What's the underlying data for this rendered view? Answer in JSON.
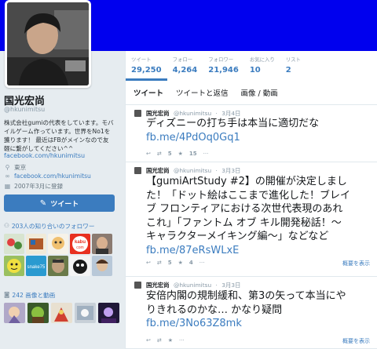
{
  "profile": {
    "name": "国光宏尚",
    "handle": "@hkunimitsu",
    "bio_lines": [
      "株式会社gumiの代表をしています。モバ",
      "イルゲーム作っています。世界をNo1を",
      "獲ります！ 最近はFBがメインなので友",
      "軽に繋がしてください^^"
    ],
    "bio_link": "facebook.com/hkunimitsu",
    "location": "東京",
    "website": "facebook.com/hkunimitsu",
    "joined": "2007年3月に登録",
    "tweet_button": "ツイート"
  },
  "stats": [
    {
      "label": "ツイート",
      "value": "29,250"
    },
    {
      "label": "フォロー",
      "value": "4,264"
    },
    {
      "label": "フォロワー",
      "value": "21,946"
    },
    {
      "label": "お気に入り",
      "value": "10"
    },
    {
      "label": "リスト",
      "value": "2"
    }
  ],
  "tabs": [
    "ツイート",
    "ツイートと返信",
    "画像 / 動画"
  ],
  "followers_section": {
    "text": "203人の知り合いのフォロワー"
  },
  "photos_section": {
    "text": "242 画像と動画"
  },
  "follower_thumbs": [
    {
      "label": ""
    },
    {
      "label": ""
    },
    {
      "label": ""
    },
    {
      "label": "kabu com"
    },
    {
      "label": ""
    },
    {
      "label": ""
    },
    {
      "label": "snake75"
    },
    {
      "label": ""
    },
    {
      "label": ""
    },
    {
      "label": ""
    }
  ],
  "tweets": [
    {
      "name": "国光宏尚",
      "screen_name": "@hkunimitsu",
      "date": "3月4日",
      "lines": [
        "ディズニーの打ち手は本当に適切だな"
      ],
      "link": "fb.me/4PdOq0Gq1",
      "retweets": "5",
      "favorites": "15",
      "expand": ""
    },
    {
      "name": "国光宏尚",
      "screen_name": "@hkunimitsu",
      "date": "3月3日",
      "lines": [
        "【gumiArtStudy #2】の開催が決定しまし",
        "た！「ドット絵はここまで進化した！ブレイ",
        "ブ フロンティアにおける次世代表現のあれ",
        "これ」「ファントム オブ キル開発秘話！～",
        "キャラクターメイキング編～」などなど"
      ],
      "link": "fb.me/87eRsWLxE",
      "retweets": "5",
      "favorites": "4",
      "expand": "概要を表示"
    },
    {
      "name": "国光宏尚",
      "screen_name": "@hkunimitsu",
      "date": "3月3日",
      "lines": [
        "安倍内閣の規制緩和、第3の矢って本当にや",
        "りきれるのかな… かなり疑問"
      ],
      "link": "fb.me/3No63Z8mk",
      "retweets": "",
      "favorites": "",
      "expand": "概要を表示"
    }
  ],
  "colors": {
    "header": "#0000ee",
    "link": "#3b7cbf",
    "button": "#3b7cbf"
  }
}
